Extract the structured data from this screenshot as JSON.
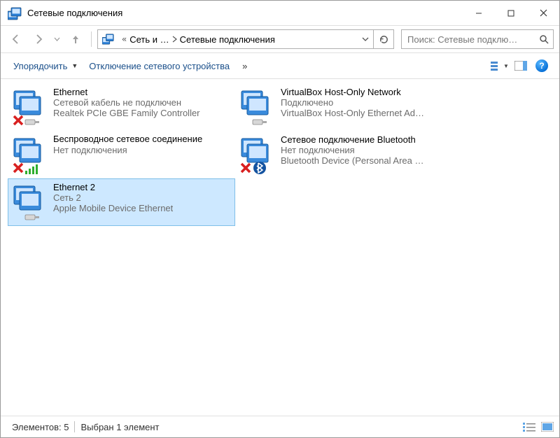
{
  "title": "Сетевые подключения",
  "breadcrumb": {
    "first_token": "«",
    "crumb1": "Сеть и …",
    "crumb2": "Сетевые подключения"
  },
  "search": {
    "placeholder": "Поиск: Сетевые подклю…"
  },
  "commands": {
    "organize": "Упорядочить",
    "disable": "Отключение сетевого устройства",
    "more_chevron": "»"
  },
  "connections": [
    {
      "name": "Ethernet",
      "status": "Сетевой кабель не подключен",
      "device": "Realtek PCIe GBE Family Controller",
      "overlay": "x-eth",
      "selected": false
    },
    {
      "name": "VirtualBox Host-Only Network",
      "status": "Подключено",
      "device": "VirtualBox Host-Only Ethernet Ad…",
      "overlay": "eth",
      "selected": false
    },
    {
      "name": "Беспроводное сетевое соединение",
      "status": "Нет подключения",
      "device": "",
      "overlay": "x-wifi",
      "selected": false,
      "two_line_name": true
    },
    {
      "name": "Сетевое подключение Bluetooth",
      "status": "Нет подключения",
      "device": "Bluetooth Device (Personal Area …",
      "overlay": "x-bt",
      "selected": false
    },
    {
      "name": "Ethernet 2",
      "status": "Сеть 2",
      "device": "Apple Mobile Device Ethernet",
      "overlay": "eth",
      "selected": true
    }
  ],
  "statusbar": {
    "count": "Элементов: 5",
    "selection": "Выбран 1 элемент"
  }
}
